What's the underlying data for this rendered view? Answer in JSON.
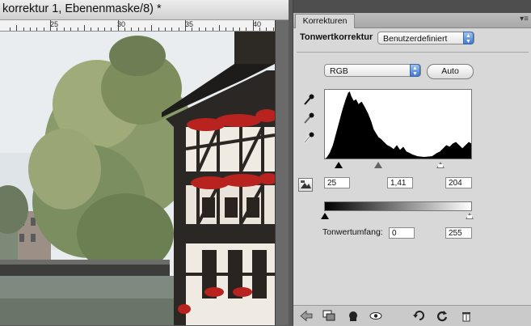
{
  "document": {
    "title": "korrektur 1, Ebenenmaske/8) *",
    "ruler_labels": [
      "25",
      "30",
      "35",
      "40"
    ]
  },
  "panel": {
    "tab_label": "Korrekturen",
    "adjustment_name": "Tonwertkorrektur",
    "preset_value": "Benutzerdefiniert",
    "channel_value": "RGB",
    "auto_label": "Auto",
    "input_levels": {
      "black": "25",
      "gamma": "1,41",
      "white": "204"
    },
    "output_label": "Tonwertumfang:",
    "output_levels": {
      "black": "0",
      "white": "255"
    },
    "icons": {
      "eyedroppers": [
        "black-point-eyedropper-icon",
        "gray-point-eyedropper-icon",
        "white-point-eyedropper-icon"
      ],
      "bottom_bar": [
        "back-arrow-icon",
        "layer-clip-icon",
        "mask-icon",
        "eye-icon",
        "reset-icon",
        "refresh-icon",
        "trash-icon"
      ]
    }
  },
  "colors": {
    "panel_bg": "#d8d8d8",
    "select_arrow": "#3d7ad6",
    "app_chrome": "#4e4e4e"
  }
}
